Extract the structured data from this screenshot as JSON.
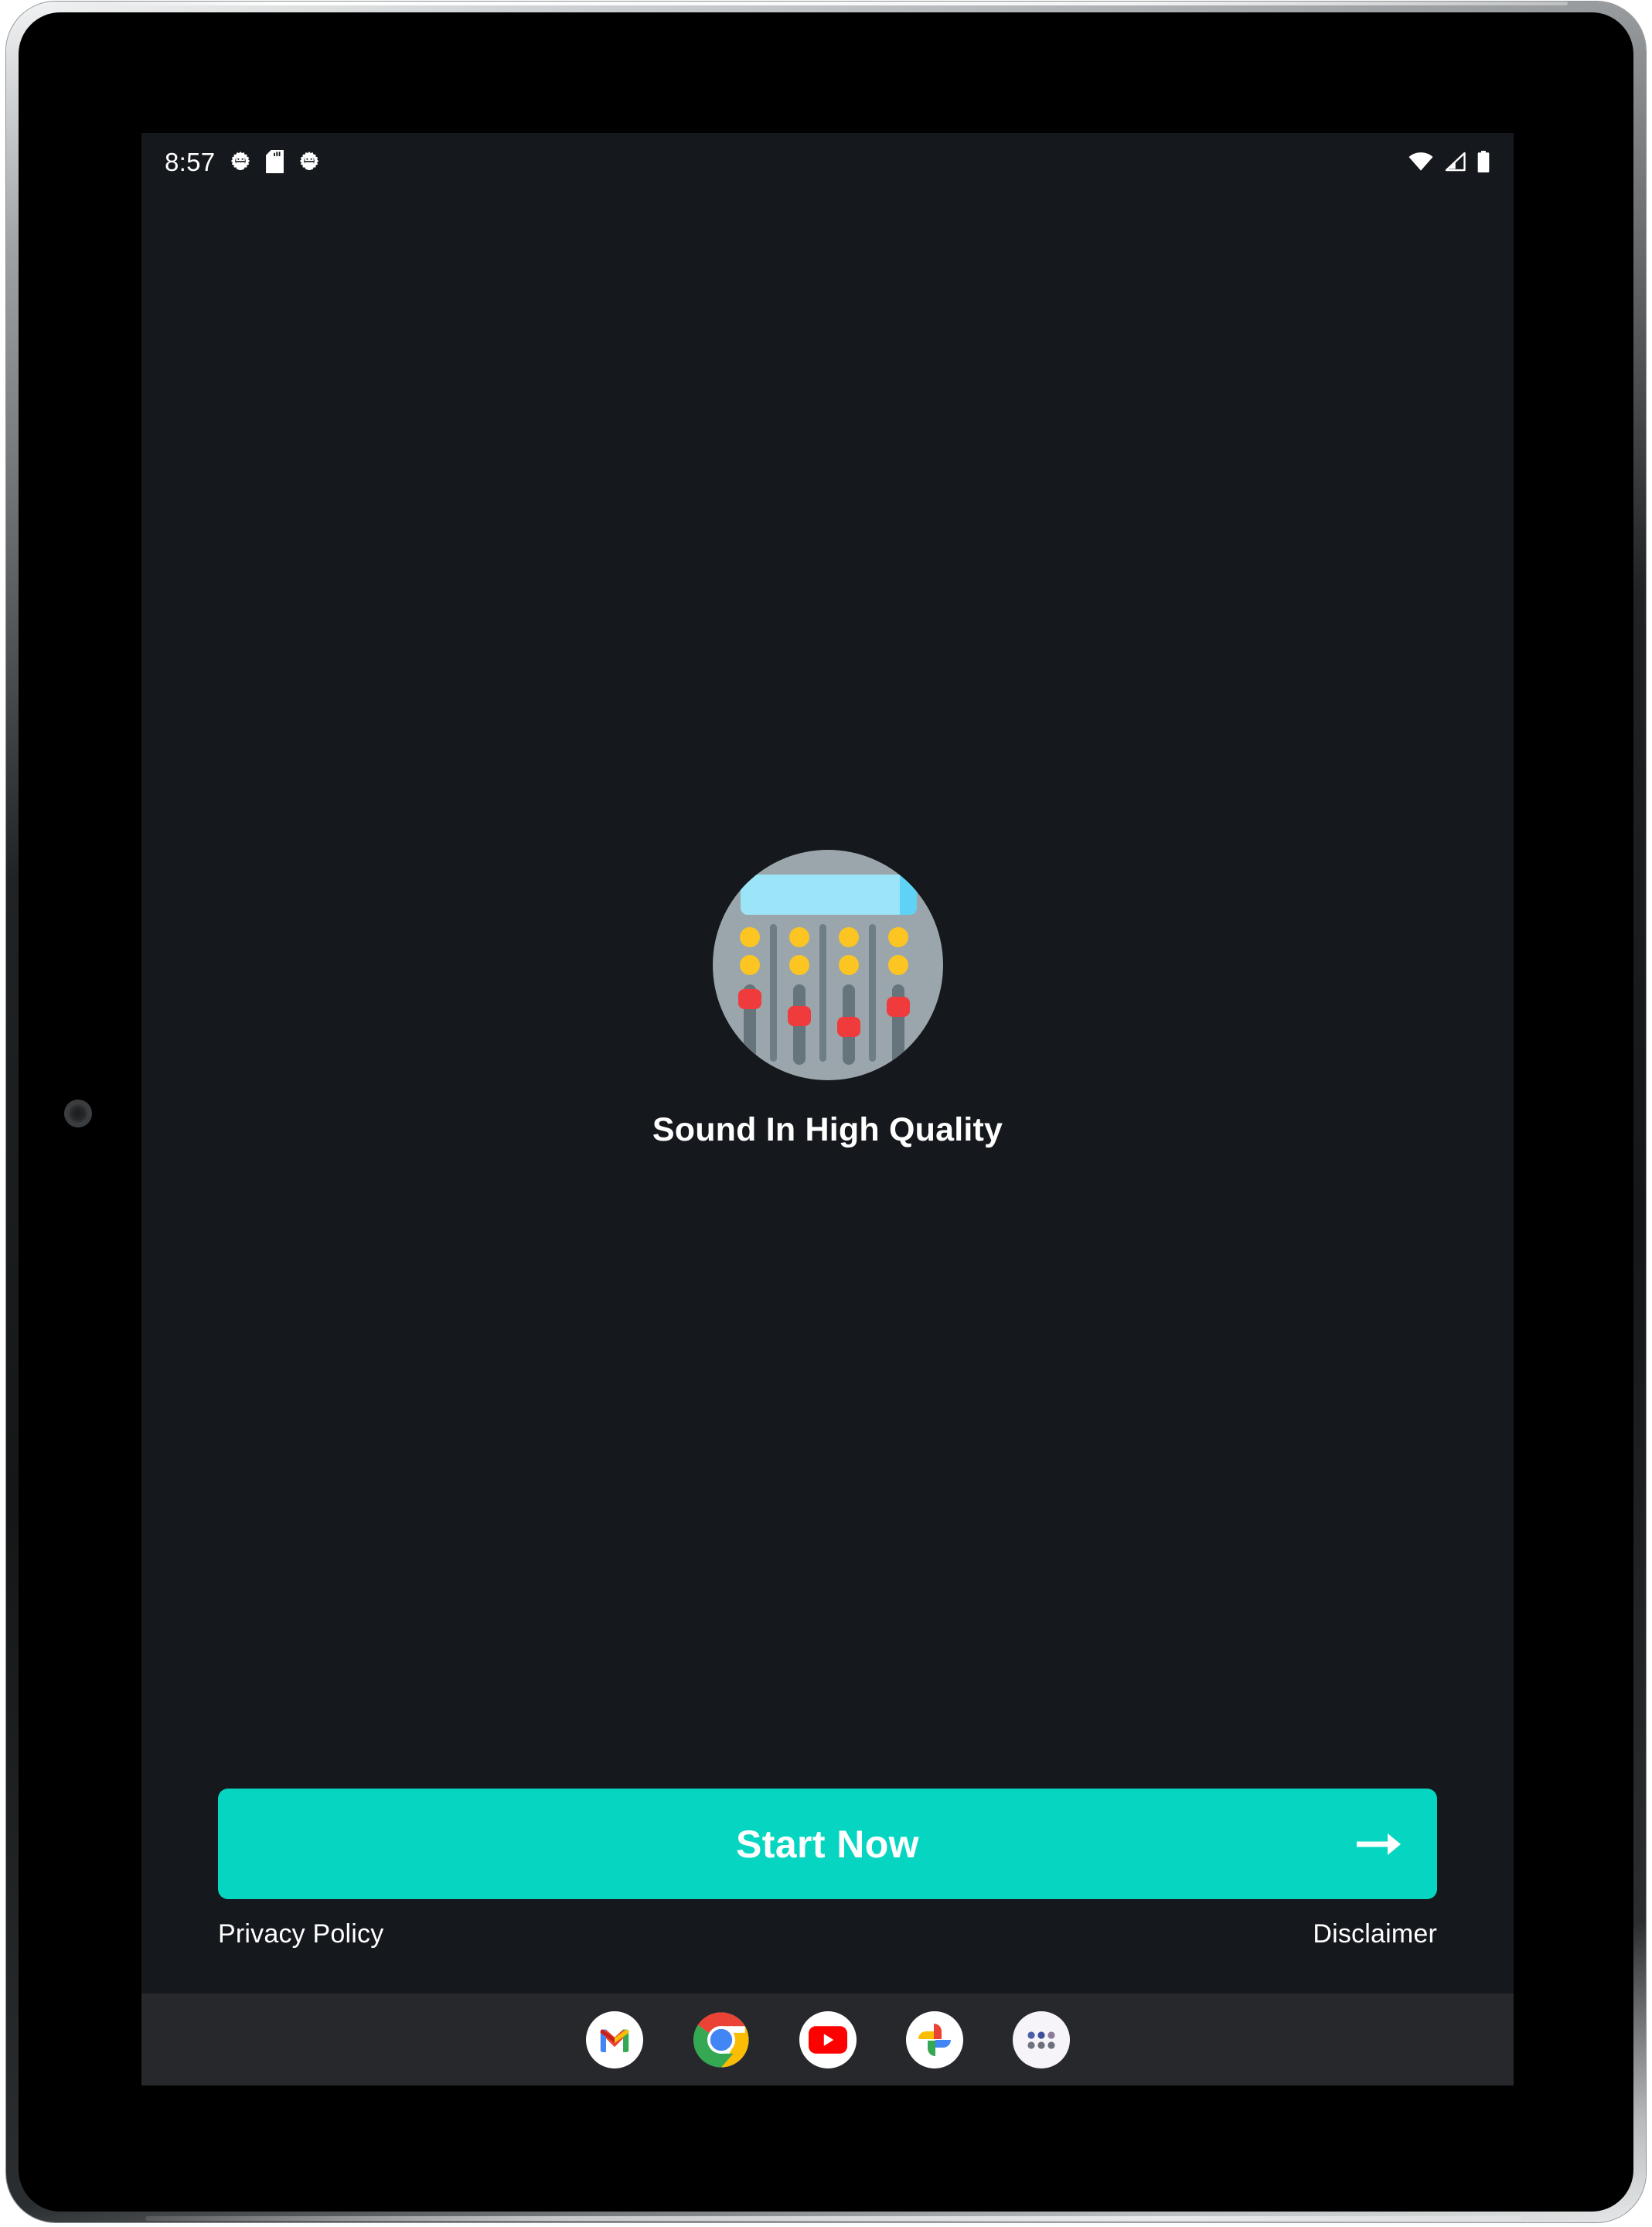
{
  "device": {
    "type": "android-tablet",
    "camera": "front-camera-lens"
  },
  "status_bar": {
    "time": "8:57",
    "left_icons": [
      "android-gear-icon",
      "sd-card-icon",
      "android-gear-icon"
    ],
    "right_icons": [
      "wifi-icon",
      "cellular-signal-icon",
      "battery-icon"
    ]
  },
  "onboarding": {
    "illustration": {
      "name": "equalizer-mixer-icon",
      "circle_color": "#9aa6ab",
      "display_color": "#9ce4f8",
      "display_edge_color": "#5fd3f5",
      "led_color": "#fcc521",
      "track_color": "#66757c",
      "thumb_color": "#ef3b3b",
      "divider_color": "#6f7d84",
      "channels": 4,
      "thumb_positions_pct": [
        6,
        38,
        56,
        20
      ]
    },
    "title": "Sound In High Quality",
    "cta": {
      "label": "Start Now",
      "icon": "arrow-right-icon",
      "background_color": "#06d6c1",
      "text_color": "#ffffff"
    },
    "links": {
      "privacy": "Privacy Policy",
      "disclaimer": "Disclaimer"
    },
    "background_color": "#15181c"
  },
  "dock": {
    "background_color": "#26282c",
    "items": [
      {
        "name": "gmail",
        "label": "Gmail"
      },
      {
        "name": "chrome",
        "label": "Chrome"
      },
      {
        "name": "youtube",
        "label": "YouTube"
      },
      {
        "name": "google-photos",
        "label": "Photos"
      },
      {
        "name": "app-drawer",
        "label": "All apps"
      }
    ]
  }
}
